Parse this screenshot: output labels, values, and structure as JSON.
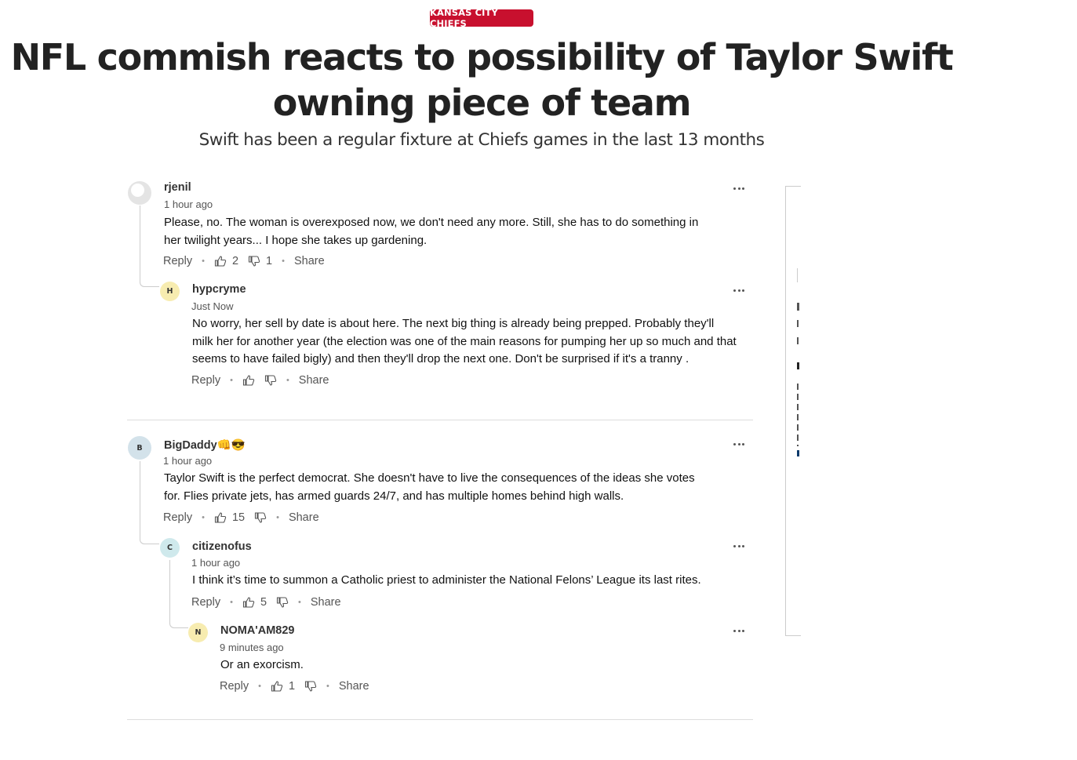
{
  "article": {
    "category": "KANSAS CITY CHIEFS",
    "headline": "NFL commish reacts to possibility of Taylor Swift owning piece of team",
    "subheadline": "Swift has been a regular fixture at Chiefs games in the last 13 months"
  },
  "labels": {
    "reply": "Reply",
    "share": "Share"
  },
  "comments": [
    {
      "user": "rjenil",
      "avatar": "default-avatar-icon",
      "time": "1 hour ago",
      "text_lines": [
        "Please, no. The woman is overexposed now, we don't need any more. Still, she has to do something in",
        "her twilight years... I hope she takes up gardening."
      ],
      "likes": "2",
      "dislikes": "1"
    },
    {
      "user": "hypcryme",
      "avatar_letter": "H",
      "time": "Just Now",
      "text_lines": [
        "No worry, her sell by date is about here.   The next big thing is already being prepped.  Probably they'll",
        "milk her for another year (the election was one of the main reasons for pumping her up so much and that",
        "seems to have failed bigly) and then they'll drop the next one.  Don't be surprised if it's a tranny ."
      ],
      "likes": "",
      "dislikes": ""
    },
    {
      "user": "BigDaddy👊😎",
      "avatar_letter": "B",
      "time": "1 hour ago",
      "text_lines": [
        "Taylor Swift is the perfect democrat. She doesn't have to live the consequences of the ideas she votes",
        "for. Flies private jets, has armed guards 24/7, and has multiple homes behind high walls."
      ],
      "likes": "15",
      "dislikes": ""
    },
    {
      "user": "citizenofus",
      "avatar_letter": "C",
      "time": "1 hour ago",
      "text_lines": [
        "I think it’s time to summon a Catholic priest to administer the National Felons’ League its last rites."
      ],
      "likes": "5",
      "dislikes": ""
    },
    {
      "user": "NOMA'AM829",
      "avatar_letter": "N",
      "time": "9 minutes ago",
      "text_lines": [
        "Or an exorcism."
      ],
      "likes": "1",
      "dislikes": ""
    }
  ]
}
